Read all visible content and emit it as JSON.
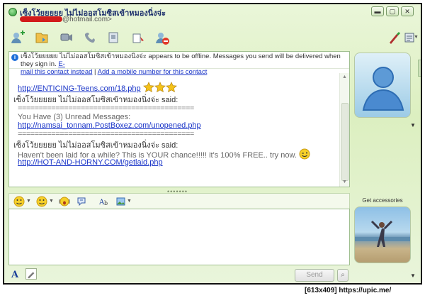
{
  "window": {
    "contact_name": "เซ็งโว้ยยยยย ไม่ไม่ออสโมซิสเข้าหมองนิ่งจ่ะ",
    "contact_email_suffix": "@hotmail.com>",
    "controls": {
      "minimize": "▬",
      "maximize": "▢",
      "close": "✕"
    }
  },
  "toolbar": {
    "icons": [
      "invite-icon",
      "send-files-icon",
      "video-icon",
      "call-icon",
      "activities-icon",
      "games-icon",
      "block-icon",
      "background-icon",
      "menu-icon"
    ]
  },
  "notice": {
    "text": "เซ็งโว้ยยยยย ไม่ไม่ออสโมซิสเข้าหมองนิ่งจ่ะ appears to be offline. Messages you send will be delivered when they sign in.",
    "email_link_a": "E-",
    "email_link_b": "mail this contact instead",
    "separator": "|",
    "mobile_link": "Add a mobile number for this contact"
  },
  "messages": {
    "link1": "http://ENTICING-Teens.com/18.php",
    "sender_said_1": "เซ็งโว้ยยยยย ไม่ไม่ออสโมซิสเข้าหมองนิ่งจ่ะ said:",
    "separator_line": "==========================================",
    "unread": "You Have (3) Unread Messages:",
    "link2": "http://namsai_tonnam.PostBoxez.com/unopened.php",
    "sender_said_2": "เซ็งโว้ยยยยย ไม่ไม่ออสโมซิสเข้าหมองนิ่งจ่ะ said:",
    "spam_text": "Haven't been laid for a while? This is YOUR chance!!!!! it's 100% FREE.. try now.",
    "link3": "http://HOT-AND-HORNY.COM/getlaid.php"
  },
  "compose": {
    "send_label": "Send",
    "search_glyph": "⌕",
    "font_glyph": "A",
    "grip": "•••••••"
  },
  "sidebar": {
    "accessories_label": "Get accessories",
    "arrow": "▼",
    "collapse_arrow": "‹"
  },
  "watermark": "[613x409] https://upic.me/",
  "colors": {
    "frame_green": "#dcefc0",
    "link_blue": "#1a35c8",
    "redaction_red": "#d21b1b"
  }
}
